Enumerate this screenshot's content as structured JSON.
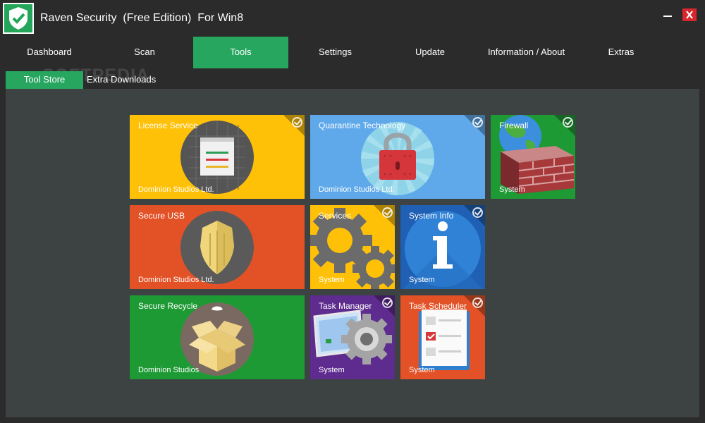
{
  "window": {
    "title": "Raven Security  (Free Edition)  For Win8",
    "logo_icon": "shield-check-icon",
    "minimize_icon": "minimize-icon",
    "close_icon": "close-icon",
    "accent_color": "#27a660"
  },
  "tabs": [
    {
      "label": "Dashboard",
      "active": false
    },
    {
      "label": "Scan",
      "active": false
    },
    {
      "label": "Tools",
      "active": true
    },
    {
      "label": "Settings",
      "active": false
    },
    {
      "label": "Update",
      "active": false
    },
    {
      "label": "Information / About",
      "active": false
    },
    {
      "label": "Extras",
      "active": false
    }
  ],
  "subtabs": [
    {
      "label": "Tool Store",
      "active": true
    },
    {
      "label": "Extra Downloads",
      "active": false
    }
  ],
  "watermark": "SOFTPEDIA",
  "tiles": [
    {
      "title": "License Service",
      "subtitle": "Dominion Studios Ltd.",
      "color": "#ffc107",
      "icon": "license-document-icon"
    },
    {
      "title": "Quarantine Technology",
      "subtitle": "Dominion Studios Ltd.",
      "color": "#5fa9ea",
      "icon": "padlock-icon"
    },
    {
      "title": "Firewall",
      "subtitle": "System",
      "color": "#1e9a35",
      "icon": "firewall-brick-icon"
    },
    {
      "title": "Secure USB",
      "subtitle": "Dominion Studios Ltd.",
      "color": "#e35126",
      "icon": "usb-shield-icon"
    },
    {
      "title": "Services",
      "subtitle": "System",
      "color": "#ffc107",
      "icon": "gears-icon"
    },
    {
      "title": "System Info",
      "subtitle": "System",
      "color": "#1f60b5",
      "icon": "info-icon"
    },
    {
      "title": "Secure Recycle",
      "subtitle": "Dominion Studios",
      "color": "#1e9a35",
      "icon": "open-box-icon"
    },
    {
      "title": "Task Manager",
      "subtitle": "System",
      "color": "#5e2b8e",
      "icon": "task-manager-gear-icon"
    },
    {
      "title": "Task Scheduler",
      "subtitle": "System",
      "color": "#e35126",
      "icon": "checklist-icon"
    }
  ]
}
